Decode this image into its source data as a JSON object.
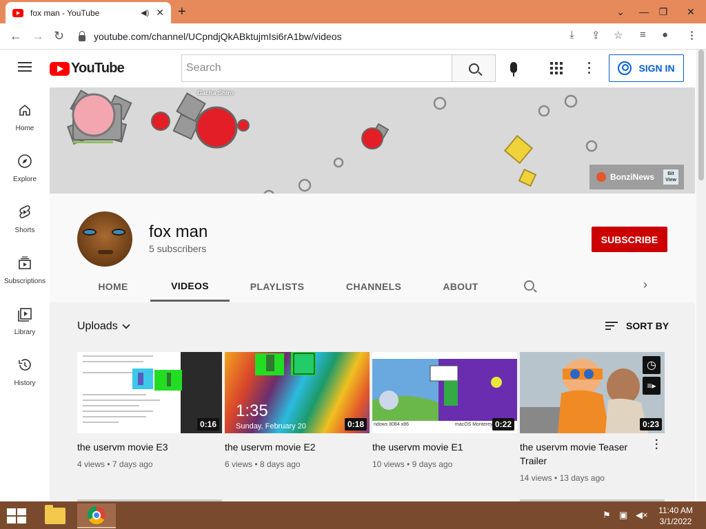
{
  "browser": {
    "tab_title": "fox man - YouTube",
    "new_tab_symbol": "+",
    "url": "youtube.com/channel/UCpndjQkABktujmIsi6rA1bw/videos"
  },
  "youtube": {
    "wordmark": "YouTube",
    "search_placeholder": "Search",
    "sign_in_label": "SIGN IN"
  },
  "sidebar": {
    "items": [
      {
        "label": "Home",
        "icon": "home-icon"
      },
      {
        "label": "Explore",
        "icon": "compass-icon"
      },
      {
        "label": "Shorts",
        "icon": "shorts-icon"
      },
      {
        "label": "Subscriptions",
        "icon": "subscriptions-icon"
      },
      {
        "label": "Library",
        "icon": "library-icon"
      },
      {
        "label": "History",
        "icon": "history-icon"
      }
    ]
  },
  "banner": {
    "player_name": "Gacha Shiro",
    "badge_text": "BonziNews",
    "badge_logo_text": "Bit View"
  },
  "channel": {
    "name": "fox man",
    "subscribers": "5 subscribers",
    "subscribe_label": "SUBSCRIBE",
    "tabs": [
      "HOME",
      "VIDEOS",
      "PLAYLISTS",
      "CHANNELS",
      "ABOUT"
    ],
    "active_tab": "VIDEOS"
  },
  "content": {
    "section_title": "Uploads",
    "sort_label": "SORT BY",
    "videos": [
      {
        "title": "the uservm movie E3",
        "duration": "0:16",
        "views": "4 views",
        "age": "7 days ago"
      },
      {
        "title": "the uservm movie E2",
        "duration": "0:18",
        "views": "6 views",
        "age": "8 days ago",
        "thumb_time": "1:35",
        "thumb_date": "Sunday, February 20"
      },
      {
        "title": "the uservm movie E1",
        "duration": "0:22",
        "views": "10 views",
        "age": "9 days ago",
        "thumb_caption_left": "ndows 8084 x86",
        "thumb_caption_right": "macOS Monterey"
      },
      {
        "title": "the uservm movie Teaser Trailer",
        "duration": "0:23",
        "views": "14 views",
        "age": "13 days ago"
      }
    ]
  },
  "taskbar": {
    "time": "11:40 AM",
    "date": "3/1/2022"
  },
  "colors": {
    "titlebar": "#e68a5c",
    "youtube_red": "#ff0000",
    "subscribe_red": "#cc0000",
    "signin_blue": "#065fd4",
    "taskbar": "#7a4a2e"
  }
}
